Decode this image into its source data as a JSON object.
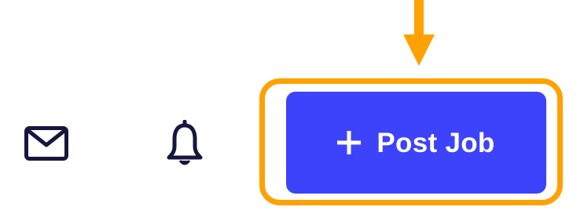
{
  "header": {
    "icons": {
      "mail": "mail-icon",
      "notifications": "bell-icon",
      "plus": "plus-icon"
    },
    "post_job_button": {
      "label": "Post Job"
    }
  },
  "annotation": {
    "highlight_color": "#FFA100",
    "arrow_color": "#FFA100",
    "target": "post-job-button"
  },
  "colors": {
    "primary": "#3D43FB",
    "icon": "#16163F",
    "button_text": "#FFFFFF"
  }
}
